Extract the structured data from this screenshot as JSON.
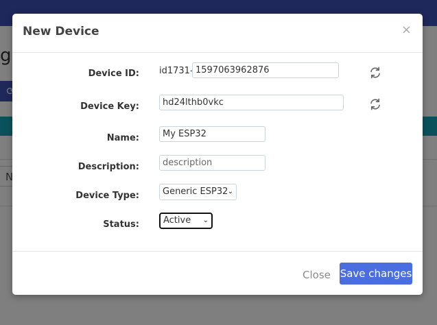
{
  "background": {
    "title_fragment": "ge",
    "table_header_fragment": "N"
  },
  "modal": {
    "title": "New Device",
    "close_symbol": "×",
    "fields": {
      "device_id": {
        "label": "Device ID:",
        "prefix": "id1731-",
        "value": "1597063962876"
      },
      "device_key": {
        "label": "Device Key:",
        "value": "hd24lthb0vkc"
      },
      "name": {
        "label": "Name:",
        "value": "My ESP32"
      },
      "description": {
        "label": "Description:",
        "value": "",
        "placeholder": "description"
      },
      "device_type": {
        "label": "Device Type:",
        "selected": "Generic ESP32"
      },
      "status": {
        "label": "Status:",
        "selected": "Active"
      }
    },
    "footer": {
      "close_label": "Close",
      "save_label": "Save changes"
    }
  },
  "colors": {
    "topbar": "#3f51b5",
    "band": "#17a2b8",
    "primary_button": "#4a6ee0"
  }
}
